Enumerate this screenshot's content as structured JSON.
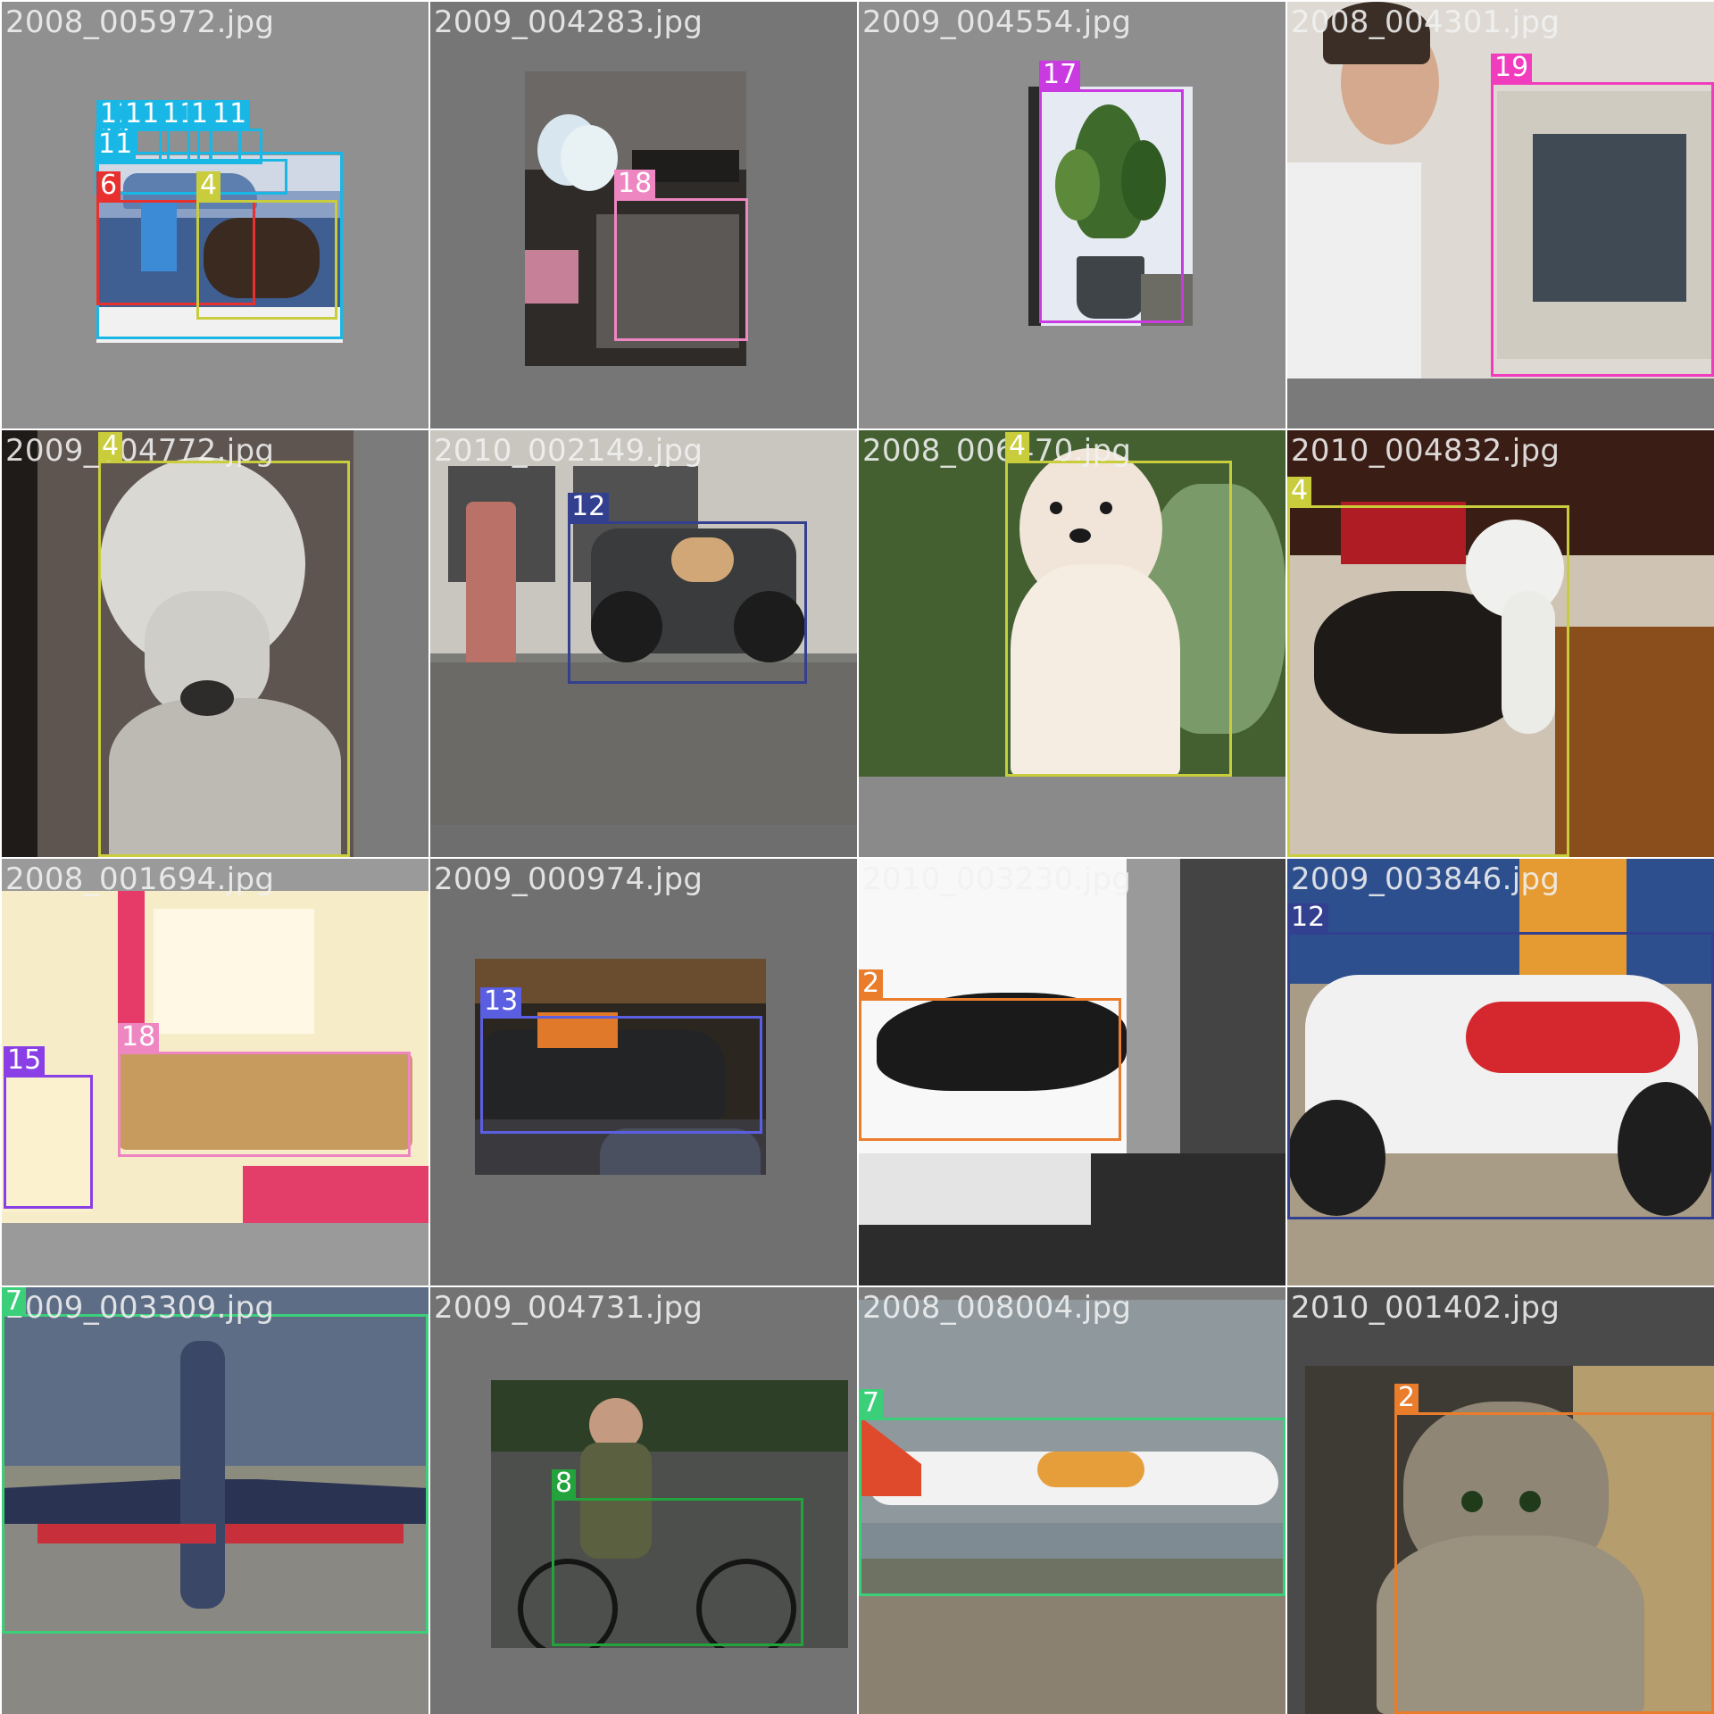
{
  "class_colors": {
    "2": "#ea7d2c",
    "4": "#c9cc3b",
    "7": "#3ccf7a",
    "8": "#23a33c",
    "11": "#19b7e6",
    "12": "#33408f",
    "13": "#5a5ee0",
    "15": "#8a3fe6",
    "17": "#c93be0",
    "18": "#ee86c2",
    "19": "#f03cbd",
    "6": "#e8302f"
  },
  "tiles": [
    {
      "file": "2008_005972.jpg",
      "bg": "#909090",
      "boxes": [
        {
          "cls": "11",
          "label": "11"
        },
        {
          "cls": "11",
          "label": "11"
        },
        {
          "cls": "11",
          "label": "11"
        },
        {
          "cls": "11",
          "label": "11"
        },
        {
          "cls": "11",
          "label": "11"
        },
        {
          "cls": "11",
          "label": "11"
        },
        {
          "cls": "11",
          "label": "11"
        },
        {
          "cls": "6",
          "label": "6"
        },
        {
          "cls": "4",
          "label": "4"
        }
      ]
    },
    {
      "file": "2009_004283.jpg",
      "bg": "#767676",
      "boxes": [
        {
          "cls": "18",
          "label": "18"
        }
      ]
    },
    {
      "file": "2009_004554.jpg",
      "bg": "#8e8e8e",
      "boxes": [
        {
          "cls": "17",
          "label": "17"
        }
      ]
    },
    {
      "file": "2008_004301.jpg",
      "bg": "#7a7a7a",
      "boxes": [
        {
          "cls": "19",
          "label": "19"
        }
      ]
    },
    {
      "file": "2009_004772.jpg",
      "bg": "#7b7b7b",
      "boxes": [
        {
          "cls": "4",
          "label": "4"
        }
      ]
    },
    {
      "file": "2010_002149.jpg",
      "bg": "#6e6e6e",
      "boxes": [
        {
          "cls": "12",
          "label": "12"
        }
      ]
    },
    {
      "file": "2008_006470.jpg",
      "bg": "#8a8a8a",
      "boxes": [
        {
          "cls": "4",
          "label": "4"
        }
      ]
    },
    {
      "file": "2010_004832.jpg",
      "bg": "#777777",
      "boxes": [
        {
          "cls": "4",
          "label": "4"
        }
      ]
    },
    {
      "file": "2008_001694.jpg",
      "bg": "#9a9a9a",
      "boxes": [
        {
          "cls": "15",
          "label": "15"
        },
        {
          "cls": "18",
          "label": "18"
        }
      ]
    },
    {
      "file": "2009_000974.jpg",
      "bg": "#707070",
      "boxes": [
        {
          "cls": "13",
          "label": "13"
        }
      ]
    },
    {
      "file": "2010_003230.jpg",
      "bg": "#efefef",
      "boxes": [
        {
          "cls": "2",
          "label": "2"
        }
      ]
    },
    {
      "file": "2009_003846.jpg",
      "bg": "#8d8d8d",
      "boxes": [
        {
          "cls": "12",
          "label": "12"
        }
      ]
    },
    {
      "file": "2009_003309.jpg",
      "bg": "#7d7d7d",
      "boxes": [
        {
          "cls": "7",
          "label": "7"
        }
      ]
    },
    {
      "file": "2009_004731.jpg",
      "bg": "#737373",
      "boxes": [
        {
          "cls": "8",
          "label": "8"
        }
      ]
    },
    {
      "file": "2008_008004.jpg",
      "bg": "#7d7d7d",
      "boxes": [
        {
          "cls": "7",
          "label": "7"
        }
      ]
    },
    {
      "file": "2010_001402.jpg",
      "bg": "#4a4a4a",
      "boxes": [
        {
          "cls": "2",
          "label": "2"
        }
      ]
    }
  ]
}
